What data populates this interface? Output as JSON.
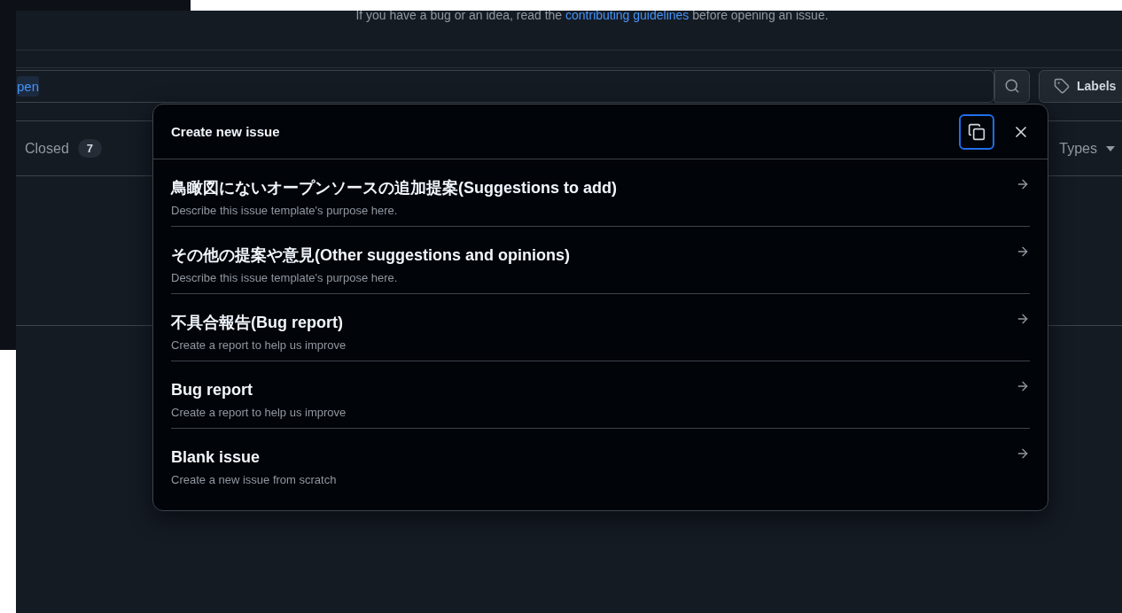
{
  "notice": {
    "before": "If you have a bug or an idea, read the ",
    "link": "contributing guidelines",
    "after": " before opening an issue."
  },
  "search": {
    "value": "pen"
  },
  "labels_button": "Labels",
  "tabs": [
    {
      "label": "Closed",
      "count": "7",
      "selected": false
    }
  ],
  "types_filter": "Types",
  "dialog": {
    "title": "Create new issue",
    "copy_button": {
      "focused": true
    },
    "templates": [
      {
        "title": "鳥瞰図にないオープンソースの追加提案(Suggestions to add)",
        "description": "Describe this issue template's purpose here."
      },
      {
        "title": "その他の提案や意見(Other suggestions and opinions)",
        "description": "Describe this issue template's purpose here."
      },
      {
        "title": "不具合報告(Bug report)",
        "description": "Create a report to help us improve"
      },
      {
        "title": "Bug report",
        "description": "Create a report to help us improve"
      },
      {
        "title": "Blank issue",
        "description": "Create a new issue from scratch"
      }
    ]
  }
}
